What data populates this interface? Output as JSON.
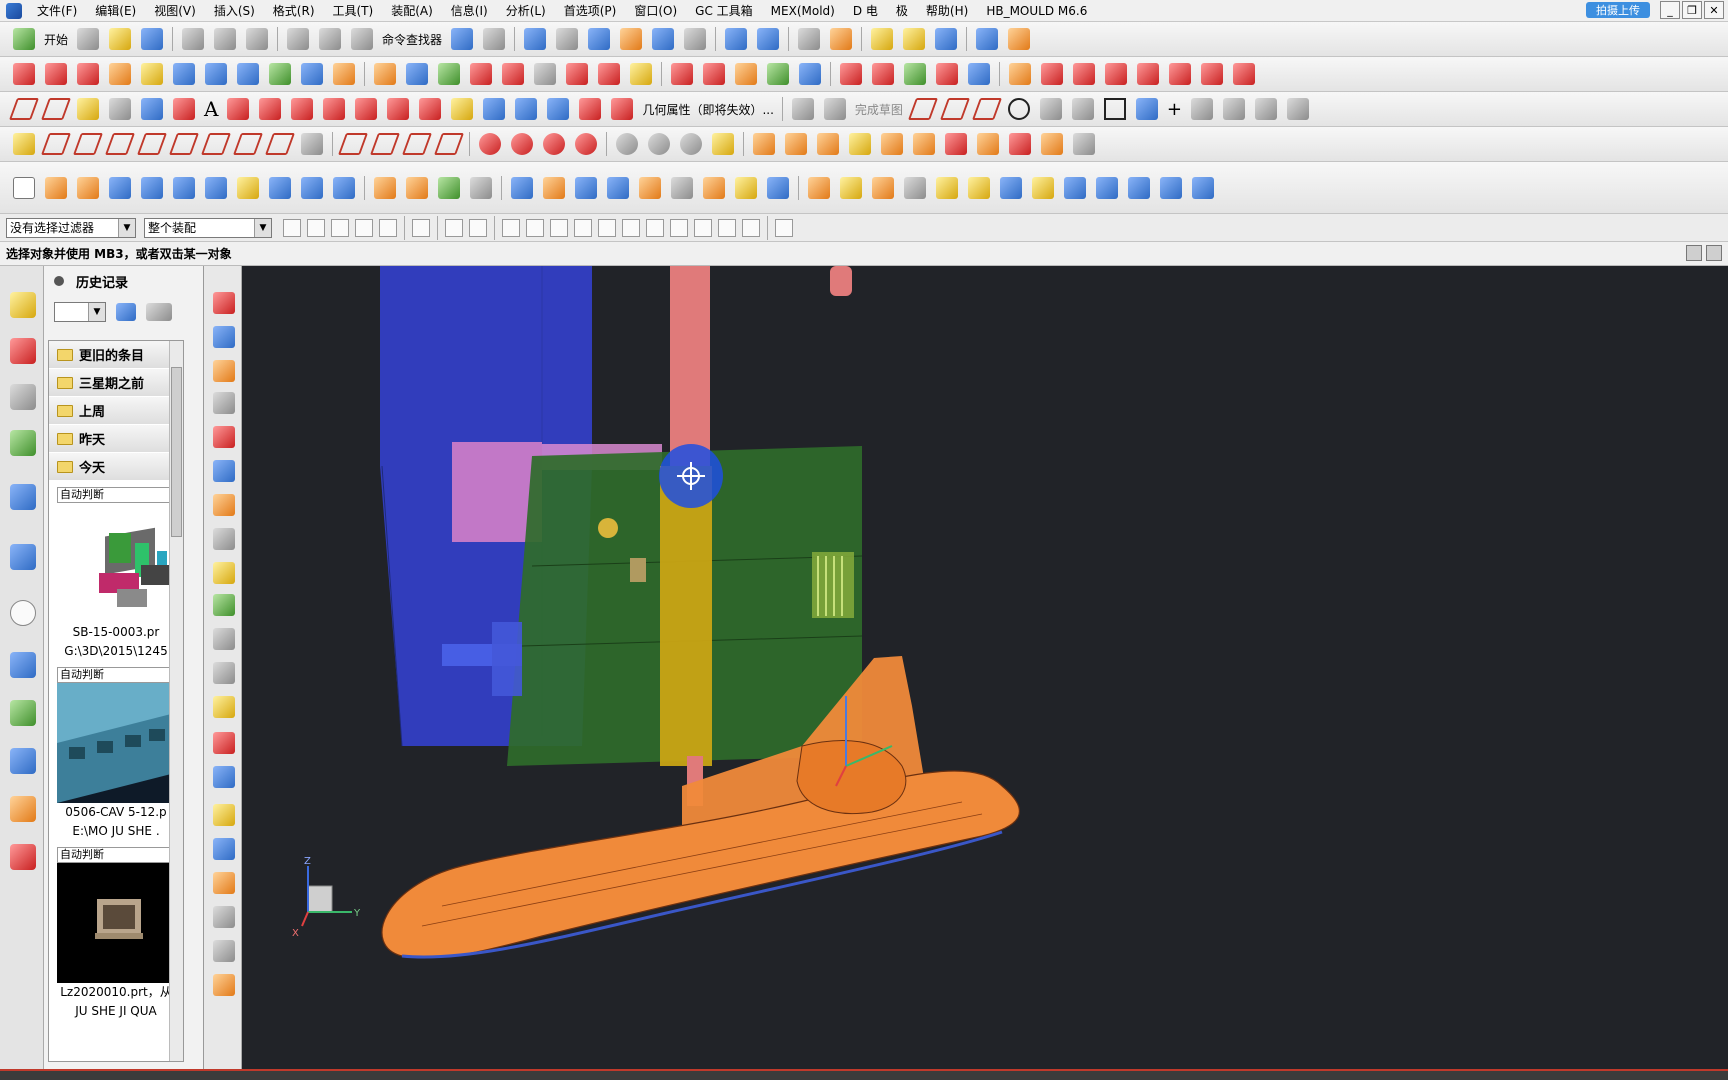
{
  "menu": [
    "文件(F)",
    "编辑(E)",
    "视图(V)",
    "插入(S)",
    "格式(R)",
    "工具(T)",
    "装配(A)",
    "信息(I)",
    "分析(L)",
    "首选项(P)",
    "窗口(O)",
    "GC 工具箱",
    "MEX(Mold)",
    "D 电",
    "极",
    "帮助(H)",
    "HB_MOULD M6.6"
  ],
  "cloud_button": "拍摄上传",
  "toolbar": {
    "start_label": "开始",
    "command_finder": "命令查找器",
    "geometry_props": "几何属性（即将失效）...",
    "finish_sketch": "完成草图"
  },
  "selection": {
    "filter": "没有选择过滤器",
    "scope": "整个装配"
  },
  "status_text": "选择对象并使用 MB3，或者双击某一对象",
  "history": {
    "title": "历史记录",
    "groups": [
      "更旧的条目",
      "三星期之前",
      "上周",
      "昨天",
      "今天"
    ],
    "cards": [
      {
        "mode": "自动判断",
        "name": "SB-15-0003.pr",
        "path": "G:\\3D\\2015\\1245"
      },
      {
        "mode": "自动判断",
        "name": "0506-CAV 5-12.p",
        "path": "E:\\MO JU SHE ."
      },
      {
        "mode": "自动判断",
        "name": "Lz2020010.prt，从",
        "path": "JU SHE JI QUA"
      }
    ]
  },
  "triad": {
    "z": "Z",
    "y": "Y",
    "x": "X"
  },
  "colors": {
    "viewport_bg": "#212328",
    "mold_blue": "#3340c9",
    "mold_green": "#2f6b2a",
    "part_orange": "#f08a3a",
    "pin_pink": "#e07a7a"
  }
}
